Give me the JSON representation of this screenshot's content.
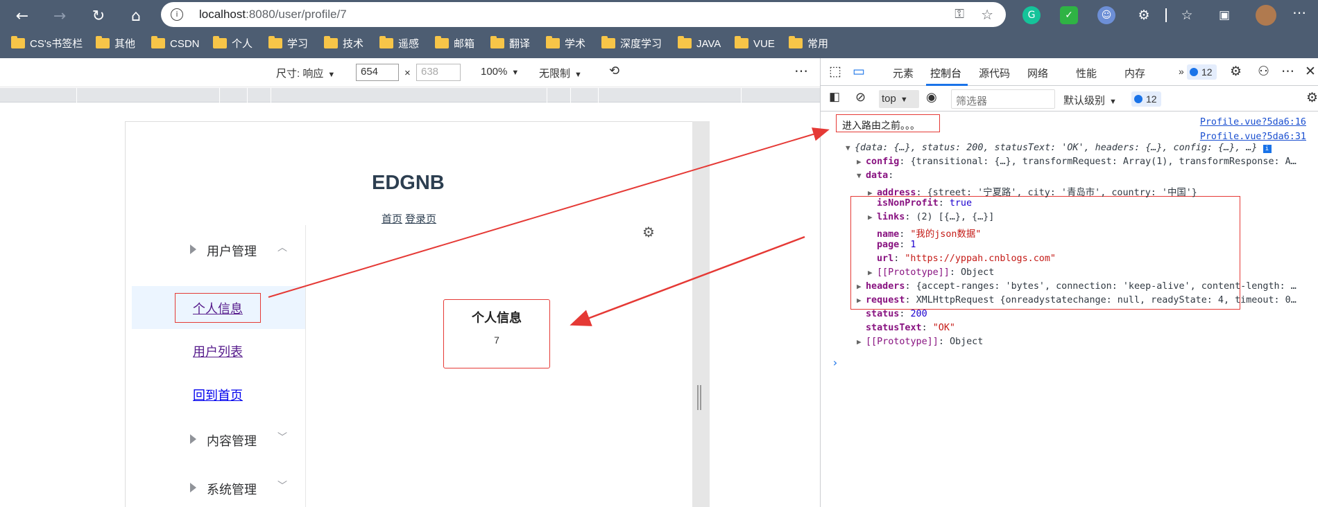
{
  "browser": {
    "url_host": "localhost",
    "url_path": ":8080/user/profile/7",
    "bookmarks": [
      "CS's书签栏",
      "其他",
      "CSDN",
      "个人",
      "学习",
      "技术",
      "遥感",
      "邮箱",
      "翻译",
      "学术",
      "深度学习",
      "JAVA",
      "VUE",
      "常用"
    ]
  },
  "device_toolbar": {
    "size_label": "尺寸: 响应",
    "width": "654",
    "height_placeholder": "638",
    "times": "×",
    "zoom": "100%",
    "throttle": "无限制"
  },
  "page": {
    "title": "EDGNB",
    "nav_links": [
      "首页",
      "登录页"
    ],
    "menu": {
      "group_user": "用户管理",
      "item_profile": "个人信息",
      "item_userlist": "用户列表",
      "item_home": "回到首页",
      "group_content": "内容管理",
      "group_system": "系统管理"
    },
    "card": {
      "title": "个人信息",
      "value": "7"
    }
  },
  "devtools": {
    "tabs": [
      "元素",
      "控制台",
      "源代码",
      "网络",
      "性能",
      "内存"
    ],
    "active_tab": "控制台",
    "issues_count": "12",
    "context": "top",
    "filter_placeholder": "筛选器",
    "level": "默认级别",
    "messages_count": "12",
    "console": {
      "log1_text": "进入路由之前。。。",
      "log1_source": "Profile.vue?5da6:16",
      "log2_source": "Profile.vue?5da6:31",
      "summary": "{data: {…}, status: 200, statusText: 'OK', headers: {…}, config: {…}, …}",
      "config_line": "{transitional: {…}, transformRequest: Array(1), transformResponse: A…",
      "address_val": "{street: '宁夏路', city: '青岛市', country: '中国'}",
      "isNonProfit_val": "true",
      "links_val": "(2) [{…}, {…}]",
      "name_val": "\"我的json数据\"",
      "page_val": "1",
      "url_val": "\"https://yppah.cnblogs.com\"",
      "proto_val": "Object",
      "headers_val": "{accept-ranges: 'bytes', connection: 'keep-alive', content-length: …",
      "request_val": "XMLHttpRequest {onreadystatechange: null, readyState: 4, timeout: 0…",
      "status_val": "200",
      "statusText_val": "\"OK\""
    }
  },
  "colors": {
    "chrome": "#4d5d72",
    "accent": "#1a73e8",
    "annotation": "#e53935",
    "folder": "#f7c548"
  }
}
